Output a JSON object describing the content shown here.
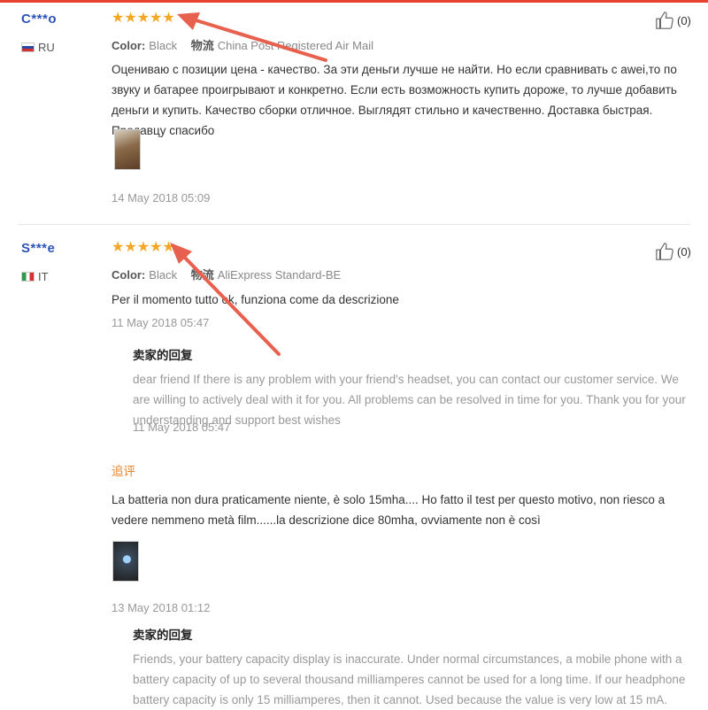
{
  "reviews": [
    {
      "user": "C***o",
      "country": "RU",
      "stars": "★★★★★",
      "color_label": "Color:",
      "color_value": "Black",
      "logistics_label": "物流",
      "logistics_value": "China Post Registered Air Mail",
      "text": "Оцениваю с позиции цена - качество. За эти деньги лучше не найти. Но если сравнивать с awei,то по звуку и батарее проигрывают и конкретно. Если есть возможность купить дороже, то лучше добавить деньги и купить. Качество сборки отличное. Выглядят стильно и качественно. Доставка быстрая. Продавцу спасибо",
      "date": "14 May 2018 05:09",
      "likes": "(0)"
    },
    {
      "user": "S***e",
      "country": "IT",
      "stars": "★★★★★",
      "color_label": "Color:",
      "color_value": "Black",
      "logistics_label": "物流",
      "logistics_value": "AliExpress Standard-BE",
      "text": "Per il momento tutto ok, funziona come da descrizione",
      "date": "11 May 2018 05:47",
      "likes": "(0)",
      "seller_reply": {
        "title": "卖家的回复",
        "text": "dear friend If there is any problem with your friend's headset, you can contact our customer service. We are willing to actively deal with it for you. All problems can be resolved in time for you. Thank you for your understanding and support best wishes",
        "date": "11 May 2018 05:47"
      },
      "append_label": "追评",
      "append_text": "La batteria non dura praticamente niente, è solo 15mha.... Ho fatto il test per questo motivo, non riesco a vedere nemmeno metà film......la descrizione dice 80mha, ovviamente non è così",
      "append_date": "13 May 2018 01:12",
      "append_reply": {
        "title": "卖家的回复",
        "text": "Friends, your battery capacity display is inaccurate. Under normal circumstances, a mobile phone with a battery capacity of up to several thousand milliamperes cannot be used for a long time. If our headphone battery capacity is only 15 milliamperes, then it cannot. Used because the value is very low at 15 mA."
      }
    }
  ],
  "icons": {
    "like": "thumbs-up-icon",
    "star": "star-icon",
    "annotation": "red-arrow-annotation"
  },
  "colors": {
    "accent": "#e8432e",
    "star": "#f5a623",
    "user": "#2d54b8",
    "append": "#e8832a"
  }
}
